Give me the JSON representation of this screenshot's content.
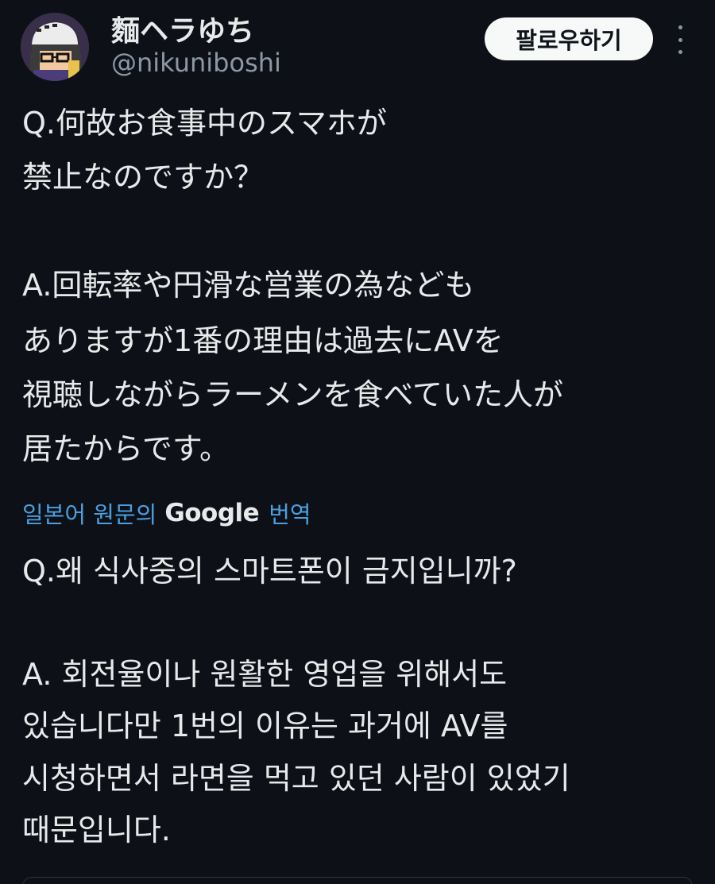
{
  "header": {
    "display_name": "麵ヘラゆち",
    "handle": "@nikuniboshi",
    "follow_label": "팔로우하기",
    "avatar_icon": "pixel-art-avatar-icon",
    "more_icon": "vertical-ellipsis-icon"
  },
  "tweet": {
    "original_lines": [
      "Q.何故お食事中のスマホが",
      "禁止なのですか？",
      "A.回転率や円滑な営業の為なども",
      "ありますが1番の理由は過去にAVを",
      "視聴しながらラーメンを食べていた人が",
      "居たからです。"
    ],
    "translation_link": {
      "prefix": "일본어 원문의",
      "brand": "Google",
      "suffix": "번역"
    },
    "translated_lines": [
      "Q.왜 식사중의 스마트폰이 금지입니까?",
      "A. 회전율이나 원활한 영업을 위해서도",
      "있습니다만 1번의 이유는 과거에 AV를",
      "시청하면서 라면을 먹고 있던 사람이 있었기",
      "때문입니다."
    ]
  },
  "colors": {
    "background": "#0d1117",
    "text": "#e7e9ea",
    "secondary_text": "#8b98a5",
    "link": "#4a9fe0",
    "button_bg": "#f7f9f9"
  }
}
